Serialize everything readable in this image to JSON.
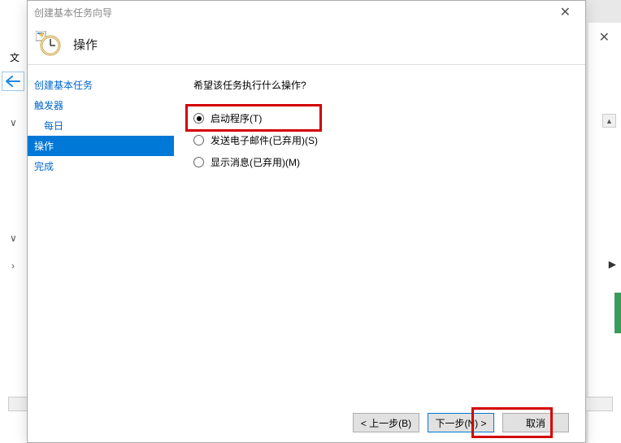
{
  "dialog": {
    "title": "创建基本任务向导",
    "header_title": "操作"
  },
  "sidebar": {
    "items": [
      {
        "label": "创建基本任务",
        "selected": false,
        "indent": false
      },
      {
        "label": "触发器",
        "selected": false,
        "indent": false
      },
      {
        "label": "每日",
        "selected": false,
        "indent": true
      },
      {
        "label": "操作",
        "selected": true,
        "indent": false
      },
      {
        "label": "完成",
        "selected": false,
        "indent": false
      }
    ]
  },
  "content": {
    "question": "希望该任务执行什么操作?",
    "options": [
      {
        "label": "启动程序(T)",
        "checked": true
      },
      {
        "label": "发送电子邮件(已弃用)(S)",
        "checked": false
      },
      {
        "label": "显示消息(已弃用)(M)",
        "checked": false
      }
    ]
  },
  "footer": {
    "back": "< 上一步(B)",
    "next": "下一步(N) >",
    "cancel": "取消"
  },
  "bg": {
    "file_fragment": "文"
  }
}
